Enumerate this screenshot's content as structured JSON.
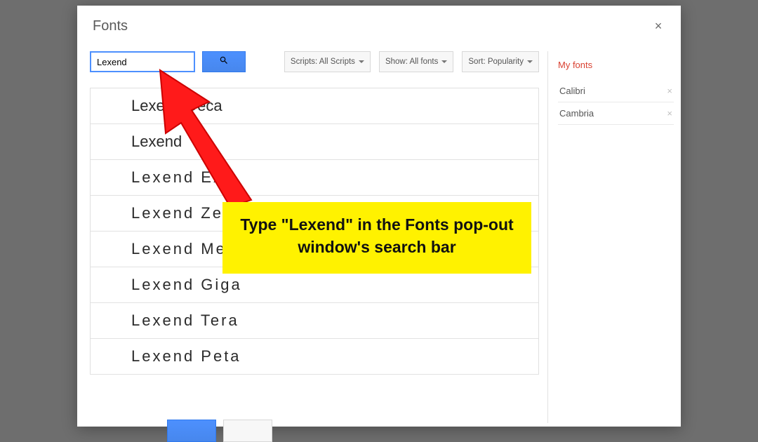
{
  "dialog": {
    "title": "Fonts",
    "close": "×"
  },
  "search": {
    "value": "Lexend"
  },
  "filters": {
    "scripts": "Scripts: All Scripts",
    "show": "Show: All fonts",
    "sort": "Sort: Popularity"
  },
  "results": [
    "Lexend Deca",
    "Lexend",
    "Lexend Exa",
    "Lexend Zetta",
    "Lexend Mega",
    "Lexend Giga",
    "Lexend Tera",
    "Lexend Peta"
  ],
  "sidebar": {
    "title": "My fonts",
    "items": [
      "Calibri",
      "Cambria"
    ],
    "remove": "×"
  },
  "annotation": {
    "text": "Type \"Lexend\" in the Fonts pop-out window's search bar"
  }
}
